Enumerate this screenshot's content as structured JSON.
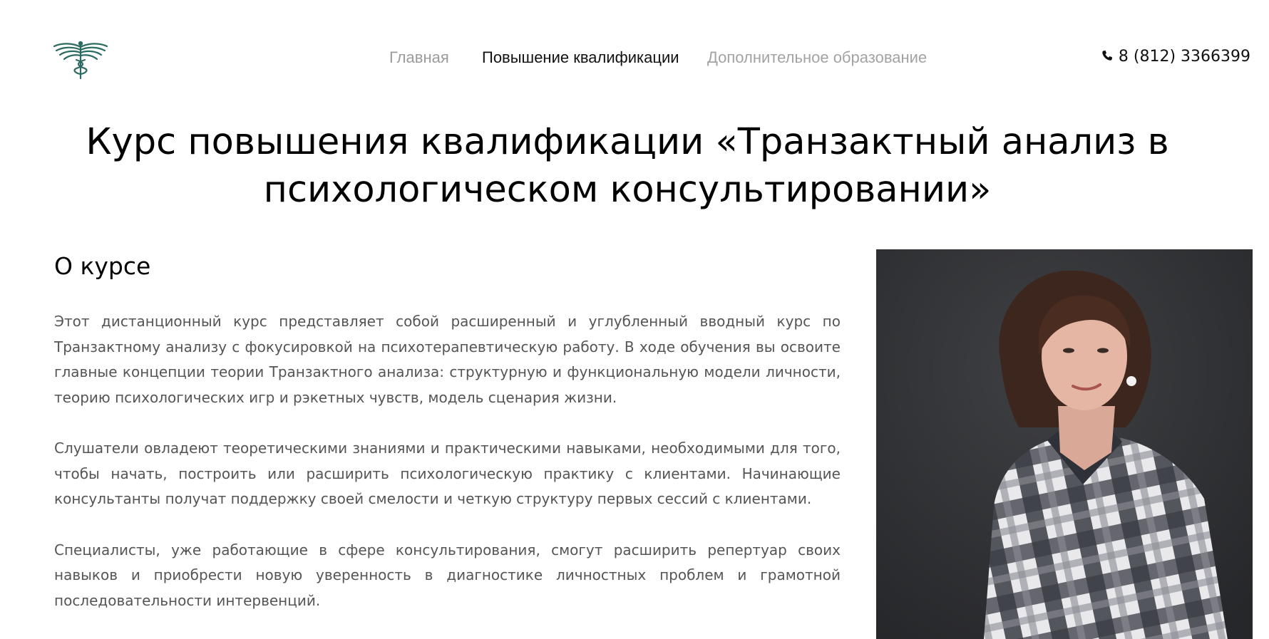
{
  "header": {
    "logo_icon": "winged-caduceus-logo-icon",
    "logo_color": "#2c6b61",
    "nav": [
      {
        "label": "Главная",
        "active": false
      },
      {
        "label": "Повышение квалификации",
        "active": true
      },
      {
        "label": "Дополнительное образование",
        "active": false
      }
    ],
    "phone_icon": "phone-icon",
    "phone": "8 (812) 3366399"
  },
  "page_title": "Курс повышения квалификации «Транзактный анализ в психологическом консультировании»",
  "about": {
    "heading": "О курсе",
    "paragraphs": [
      "Этот дистанционный курс представляет собой расширенный и углубленный вводный курс по Транзактному анализу с фокусировкой на психотерапевтическую работу. В ходе обучения вы освоите главные концепции теории Транзактного анализа: структурную и функциональную модели личности, теорию психологических игр и рэкетных чувств, модель сценария жизни.",
      "Слушатели овладеют теоретическими знаниями и практическими навыками, необходимыми для того, чтобы начать, построить или расширить психологическую практику с клиентами. Начинающие консультанты получат поддержку своей смелости и четкую структуру первых сессий с клиентами.",
      "Специалисты, уже работающие в сфере консультирования, смогут расширить репертуар своих навыков и приобрести новую уверенность в диагностике личностных проблем и грамотной последовательности интервенций."
    ]
  },
  "photo": {
    "description_icon": "instructor-portrait-photo",
    "background": "#2e2f31"
  }
}
